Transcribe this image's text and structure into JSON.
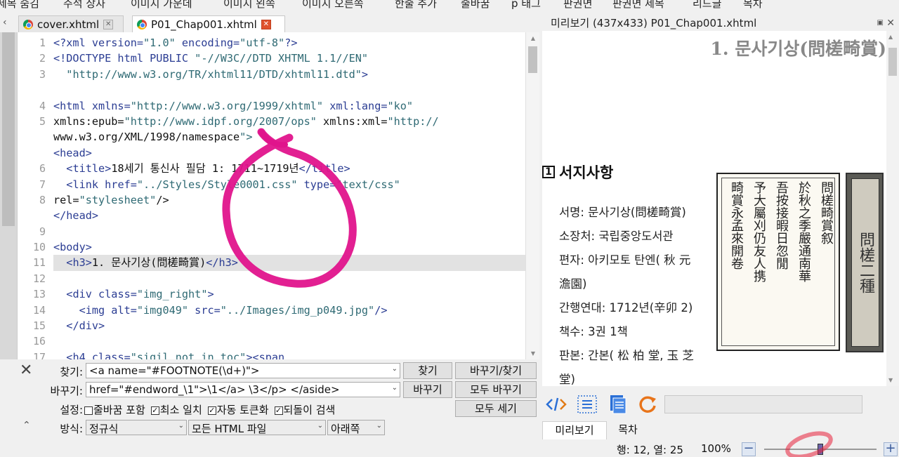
{
  "menu": [
    "제목 숨김",
    "주석 상자",
    "이미지 가운데",
    "이미지 왼쪽",
    "이미지 오른쪽",
    "한줄 추가",
    "줄바꿈",
    "p 태그",
    "판권면",
    "판권면 제목",
    "리드글",
    "목차"
  ],
  "tabs": [
    {
      "label": "cover.xhtml",
      "active": false
    },
    {
      "label": "P01_Chap001.xhtml",
      "active": true
    }
  ],
  "editor": {
    "line_numbers": [
      "1",
      "2",
      "3",
      "",
      "4",
      "5",
      "",
      "",
      "6",
      "7",
      "8",
      "",
      "9",
      "10",
      "11",
      "12",
      "13",
      "14",
      "15",
      "16",
      "17"
    ],
    "lines": [
      {
        "t": "<?xml version=\"1.0\" encoding=\"utf-8\"?>"
      },
      {
        "t": "<!DOCTYPE html PUBLIC \"-//W3C//DTD XHTML 1.1//EN\""
      },
      {
        "t": "  \"http://www.w3.org/TR/xhtml11/DTD/xhtml11.dtd\">"
      },
      {
        "t": ""
      },
      {
        "t": "<html xmlns=\"http://www.w3.org/1999/xhtml\" xml:lang=\"ko\""
      },
      {
        "t": "xmlns:epub=\"http://www.idpf.org/2007/ops\" xmlns:xml=\"http://"
      },
      {
        "t": "www.w3.org/XML/1998/namespace\">"
      },
      {
        "t": "<head>"
      },
      {
        "t": "  <title>18세기 통신사 필담 1: 1711~1719년</title>"
      },
      {
        "t": "  <link href=\"../Styles/Style0001.css\" type=\"text/css\""
      },
      {
        "t": "rel=\"stylesheet\"/>"
      },
      {
        "t": "</head>"
      },
      {
        "t": ""
      },
      {
        "t": "<body>"
      },
      {
        "t": "  <h3>1. 문사기상(問槎畸賞)</h3>",
        "hl": true
      },
      {
        "t": ""
      },
      {
        "t": "  <div class=\"img_right\">"
      },
      {
        "t": "    <img alt=\"img049\" src=\"../Images/img_p049.jpg\"/>"
      },
      {
        "t": "  </div>"
      },
      {
        "t": ""
      },
      {
        "t": "  <h4 class=\"sigil_not_in_toc\"><span"
      }
    ]
  },
  "find": {
    "find_label": "찾기:",
    "find_value": "<a name=\"#FOOTNOTE(\\d+)\">",
    "replace_label": "바꾸기:",
    "replace_value": "href=\"#endword_\\1\">\\1</a> \\3</p>      </aside>",
    "options_label": "설정:",
    "options": [
      {
        "label": "줄바꿈 포함",
        "checked": false
      },
      {
        "label": "최소 일치",
        "checked": true
      },
      {
        "label": "자동 토큰화",
        "checked": true
      },
      {
        "label": "되돌이 검색",
        "checked": true
      }
    ],
    "mode_label": "방식:",
    "mode_value": "정규식",
    "scope_value": "모든 HTML 파일",
    "direction_value": "아래쪽",
    "buttons": {
      "find": "찾기",
      "replace_find": "바꾸기/찾기",
      "replace": "바꾸기",
      "replace_all": "모두 바꾸기",
      "count_all": "모두 세기"
    }
  },
  "preview": {
    "title": "미리보기 (437x433) P01_Chap001.xhtml",
    "h3": "1. 문사기상(問槎畸賞)",
    "h4_num": "1",
    "h4": "서지사항",
    "info": [
      "서명: 문사기상(問槎畸賞)",
      "소장처: 국립중앙도서관",
      "편자: 아키모토 탄엔( 秋 元",
      "澹園)",
      "간행연대: 1712년(辛卯 2)",
      "책수: 3권 1책",
      "판본: 간본( 松 柏 堂, 玉 芝",
      "堂)"
    ],
    "img_main_cols": [
      "問槎畸賞叙",
      "於秋之季嚴通南華",
      "吾按接暇日忽閒",
      "予大屬刈仍友人携",
      "畸賞永孟來開卷"
    ],
    "img_side_label": "問槎二種",
    "tabs": [
      "미리보기",
      "목차"
    ]
  },
  "status": {
    "position": "행: 12, 열: 25",
    "zoom": "100%",
    "zoom_level": 0.5
  },
  "icons": [
    "code-view-icon",
    "split-view-icon",
    "document-icon",
    "refresh-icon"
  ],
  "colors": {
    "highlight_pen": "#e0148c",
    "tag_blue": "#2b3d93",
    "attr_teal": "#2f6a74"
  }
}
